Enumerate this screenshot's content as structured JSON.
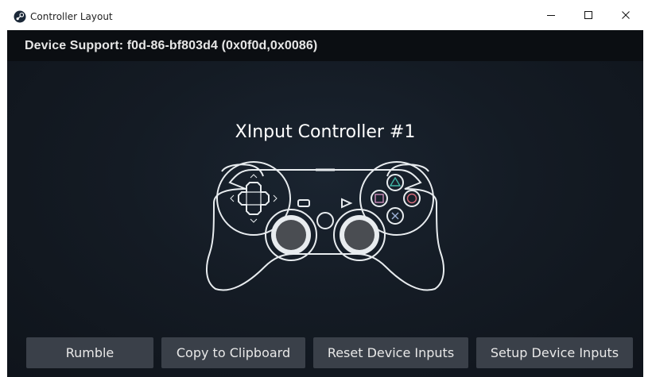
{
  "window": {
    "title": "Controller Layout",
    "icon": "steam-icon"
  },
  "header": {
    "device_support": "Device Support: f0d-86-bf803d4 (0x0f0d,0x0086)"
  },
  "controller": {
    "name": "XInput Controller #1",
    "image": "gamepad-outline-icon"
  },
  "buttons": {
    "rumble": "Rumble",
    "copy": "Copy to Clipboard",
    "reset": "Reset Device Inputs",
    "setup": "Setup Device Inputs"
  },
  "colors": {
    "face_triangle": "#41b6a6",
    "face_circle": "#d86a7a",
    "face_square": "#c98ab8"
  }
}
